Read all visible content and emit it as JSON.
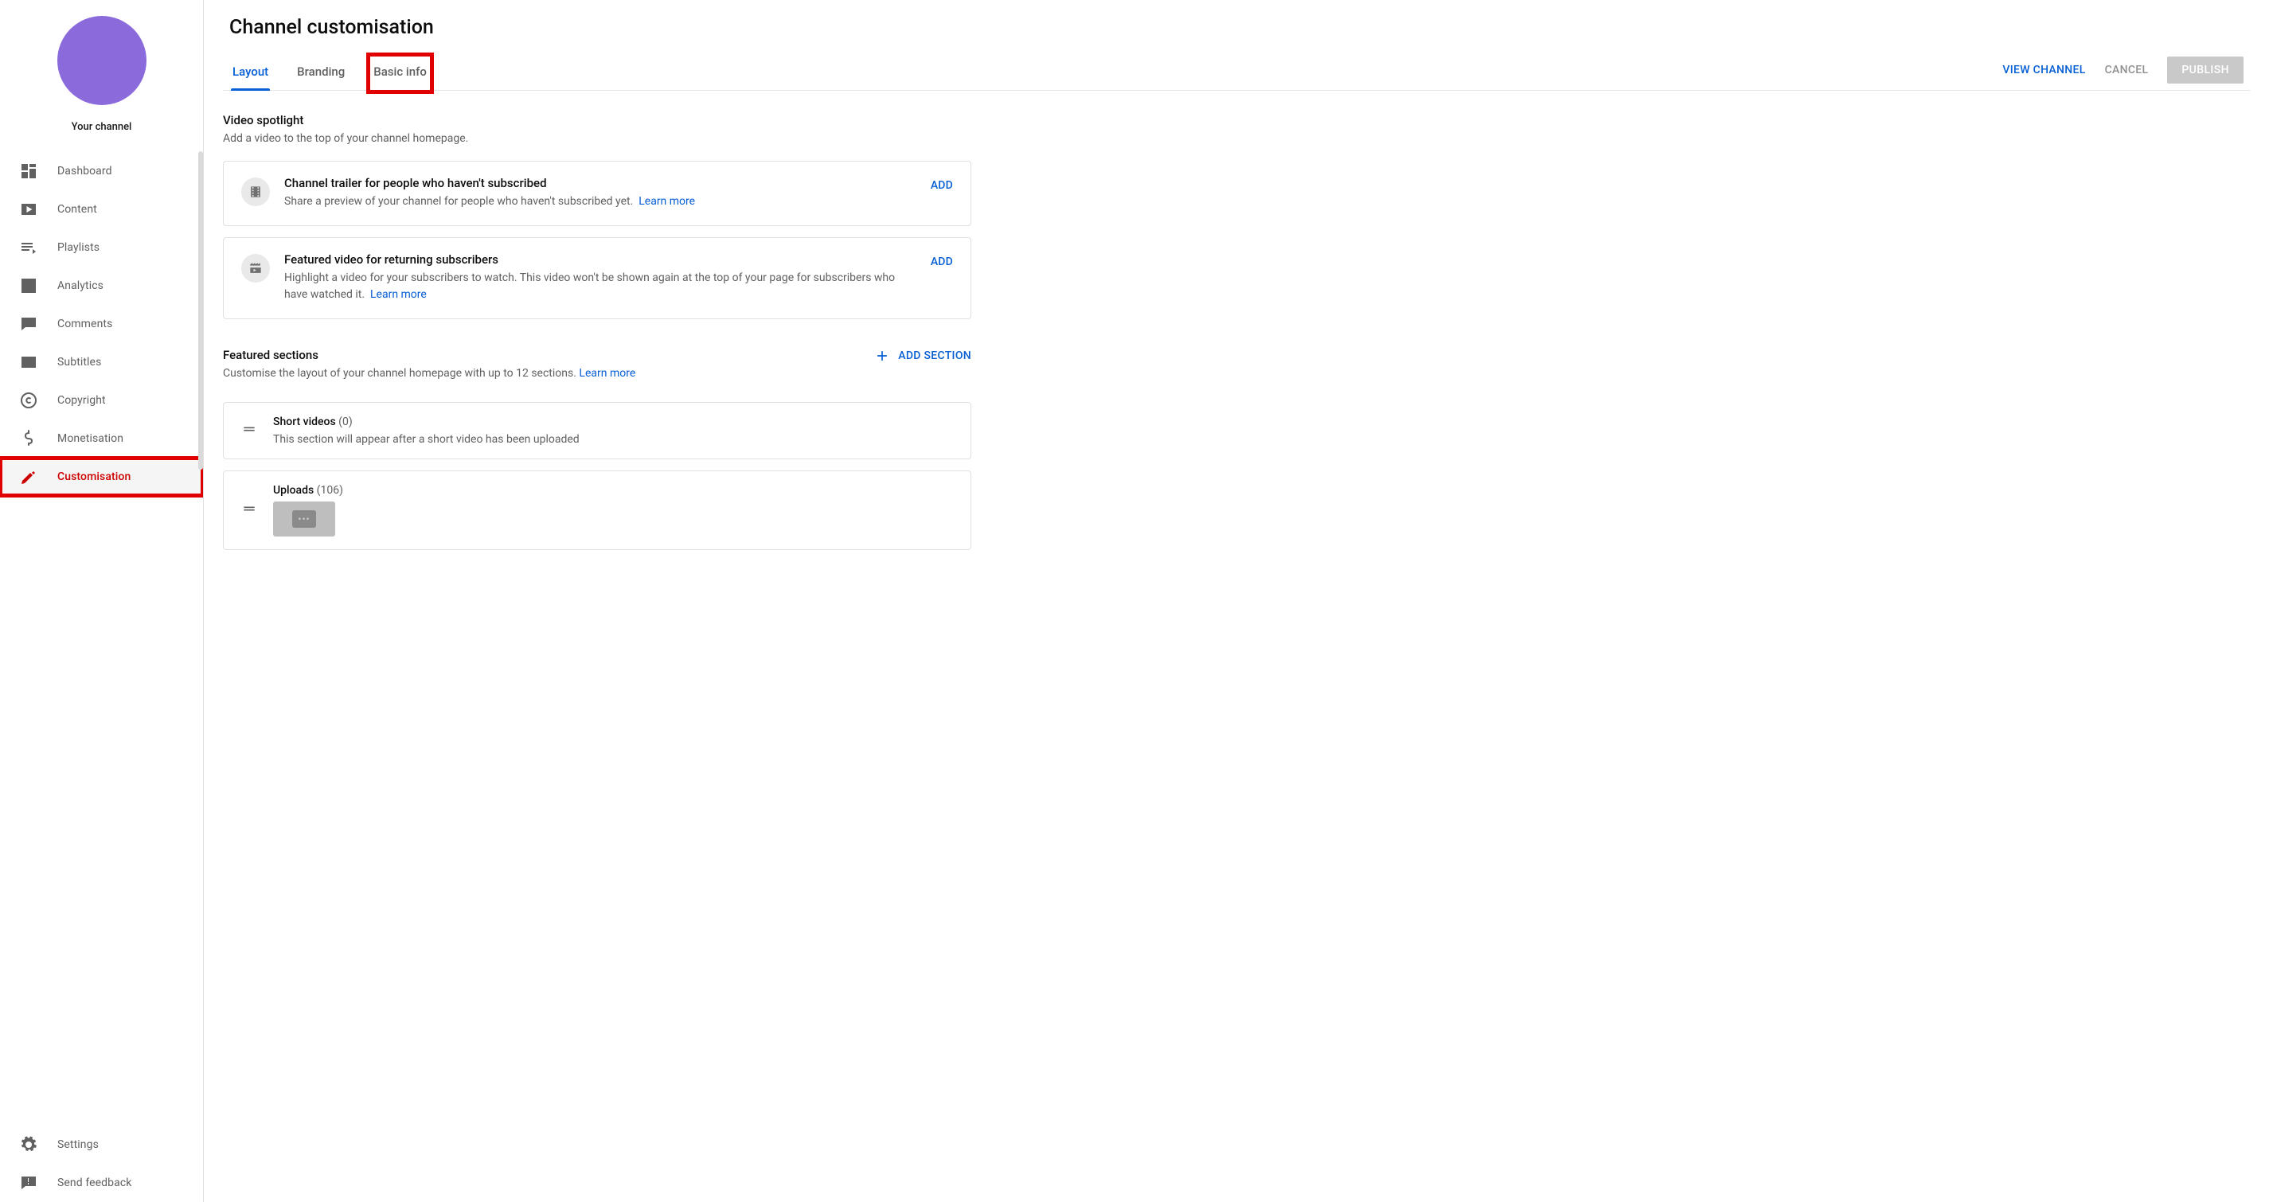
{
  "sidebar": {
    "channel_label": "Your channel",
    "items": [
      {
        "label": "Dashboard",
        "icon": "dashboard"
      },
      {
        "label": "Content",
        "icon": "content"
      },
      {
        "label": "Playlists",
        "icon": "playlists"
      },
      {
        "label": "Analytics",
        "icon": "analytics"
      },
      {
        "label": "Comments",
        "icon": "comments"
      },
      {
        "label": "Subtitles",
        "icon": "subtitles"
      },
      {
        "label": "Copyright",
        "icon": "copyright"
      },
      {
        "label": "Monetisation",
        "icon": "monetisation"
      },
      {
        "label": "Customisation",
        "icon": "customisation"
      }
    ],
    "footer": [
      {
        "label": "Settings",
        "icon": "settings"
      },
      {
        "label": "Send feedback",
        "icon": "feedback"
      }
    ]
  },
  "page": {
    "title": "Channel customisation",
    "tabs": [
      {
        "label": "Layout"
      },
      {
        "label": "Branding"
      },
      {
        "label": "Basic info"
      }
    ],
    "actions": {
      "view": "VIEW CHANNEL",
      "cancel": "CANCEL",
      "publish": "PUBLISH"
    }
  },
  "spotlight": {
    "title": "Video spotlight",
    "desc": "Add a video to the top of your channel homepage.",
    "cards": [
      {
        "title": "Channel trailer for people who haven't subscribed",
        "desc": "Share a preview of your channel for people who haven't subscribed yet.",
        "learn": "Learn more",
        "action": "ADD"
      },
      {
        "title": "Featured video for returning subscribers",
        "desc": "Highlight a video for your subscribers to watch. This video won't be shown again at the top of your page for subscribers who have watched it.",
        "learn": "Learn more",
        "action": "ADD"
      }
    ]
  },
  "featured": {
    "title": "Featured sections",
    "desc": "Customise the layout of your channel homepage with up to 12 sections.",
    "learn": "Learn more",
    "add_section": "ADD SECTION",
    "rows": [
      {
        "title": "Short videos",
        "count": "(0)",
        "desc": "This section will appear after a short video has been uploaded"
      },
      {
        "title": "Uploads",
        "count": "(106)"
      }
    ]
  },
  "colors": {
    "accent": "#065fd4",
    "active": "#cc0000",
    "avatar": "#8b6adc",
    "highlight": "#e00000"
  }
}
